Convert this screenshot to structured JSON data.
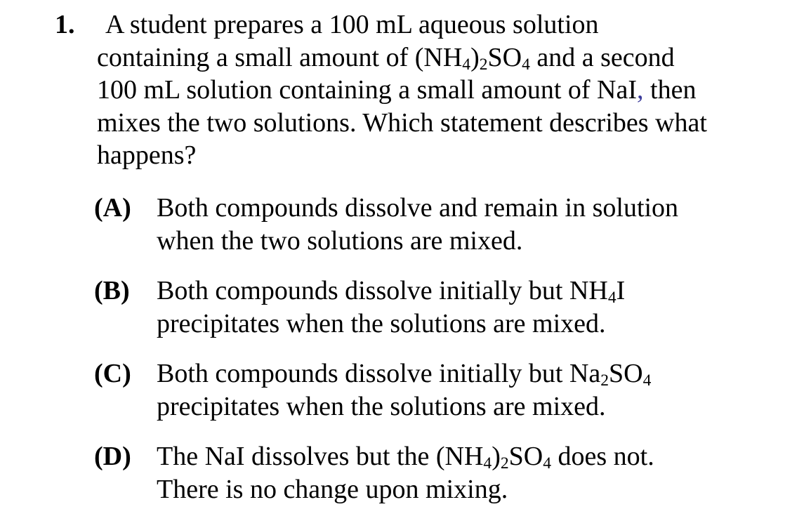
{
  "question": {
    "number": "1.",
    "stem": {
      "line1": "A student prepares a 100 mL aqueous solution",
      "line2_pre": "containing a small amount of (NH",
      "line2_sub1": "4",
      "line2_mid1": ")",
      "line2_sub2": "2",
      "line2_mid2": "SO",
      "line2_sub3": "4",
      "line2_post": " and a second",
      "line3_pre": "100 mL solution containing a small amount of NaI",
      "line3_comma": ",",
      "line3_post": " then",
      "line4": "mixes the two solutions. Which statement describes what",
      "line5": "happens?"
    }
  },
  "choices": {
    "a": {
      "letter": "(A)",
      "line1": "Both compounds dissolve and remain in solution",
      "line2": "when the two solutions are mixed."
    },
    "b": {
      "letter": "(B)",
      "line1_pre": "Both compounds dissolve initially but NH",
      "line1_sub": "4",
      "line1_post": "I",
      "line2": "precipitates when the solutions are mixed."
    },
    "c": {
      "letter": "(C)",
      "line1_pre": "Both compounds dissolve initially but Na",
      "line1_sub1": "2",
      "line1_mid": "SO",
      "line1_sub2": "4",
      "line2": "precipitates when the solutions are mixed."
    },
    "d": {
      "letter": "(D)",
      "line1_pre": "The NaI dissolves but the (NH",
      "line1_sub1": "4",
      "line1_mid1": ")",
      "line1_sub2": "2",
      "line1_mid2": "SO",
      "line1_sub3": "4",
      "line1_post": " does not.",
      "line2": "There is no change upon mixing."
    }
  },
  "colors": {
    "text": "#000000",
    "comma_accent": "#3a3a9a",
    "background": "#ffffff"
  }
}
